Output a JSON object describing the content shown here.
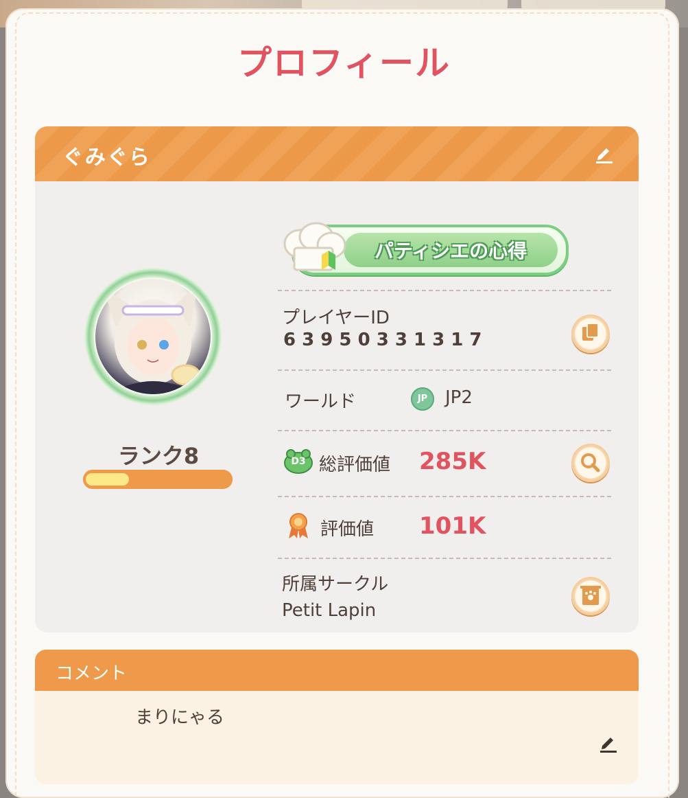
{
  "page": {
    "title": "プロフィール"
  },
  "profile": {
    "player_name": "ぐみぐら",
    "rank_label": "ランク8",
    "rank_progress": 0.3,
    "title_badge": "パティシエの心得",
    "player_id_label": "プレイヤーID",
    "player_id": "6 3 9 5 0 3 3 1 3 1 7",
    "world_label": "ワールド",
    "world_icon_text": "JP",
    "world_value": "JP2",
    "total_rating_icon_text": "D3",
    "total_rating_label": "総評価値",
    "total_rating_value": "285K",
    "rating_label": "評価値",
    "rating_value": "101K",
    "circle_label": "所属サークル",
    "circle_value": "Petit Lapin"
  },
  "comment": {
    "header": "コメント",
    "text": "まりにゃる"
  },
  "icons": {
    "edit_name": "pencil-icon",
    "copy": "copy-icon",
    "search": "magnifier-icon",
    "circle": "circle-banner-icon",
    "edit_comment": "pencil-icon",
    "rating": "ribbon-medal-icon",
    "total_rating": "d3-frog-icon",
    "world": "jp-globe-icon",
    "title": "chef-hat-icon"
  },
  "colors": {
    "accent_orange": "#ee9a4a",
    "title_red": "#e0535f",
    "badge_green": "#7ccf82"
  }
}
